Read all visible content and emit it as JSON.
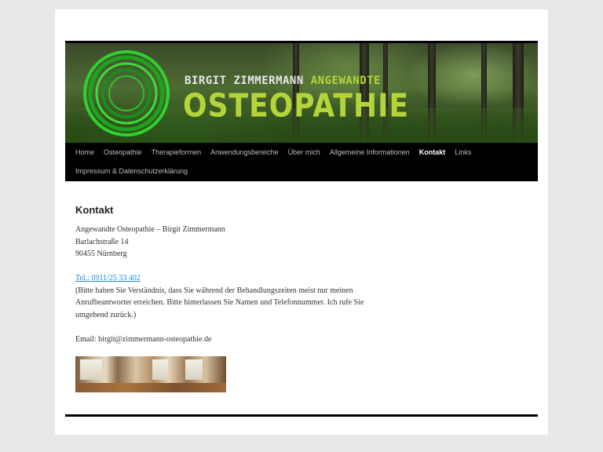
{
  "header": {
    "brand_name": "BIRGIT ZIMMERMANN",
    "brand_accent": "ANGEWANDTE",
    "brand_title": "OSTEOPATHIE",
    "brand_color": "#b4d43a"
  },
  "nav": {
    "row1": [
      "Home",
      "Osteopathie",
      "Therapieformen",
      "Anwendungsbereiche",
      "Über mich",
      "Allgemeine Informationen",
      "Kontakt",
      "Links"
    ],
    "row2": [
      "Impressum & Datenschutzerklärung"
    ],
    "active": "Kontakt"
  },
  "content": {
    "title": "Kontakt",
    "address": [
      "Angewandte Osteopathie – Birgit Zimmermann",
      "Barlachstraße 14",
      "90455 Nürnberg"
    ],
    "phone_link": "Tel.: 0911/25 33 402",
    "note_lines": [
      "(Bitte haben Sie Verständnis, dass Sie während der Behandlungszeiten meist nur meinen",
      "Anrufbeantworter erreichen. Bitte hinterlassen Sie Namen und Telefonnummer. Ich rufe Sie",
      "umgehend zurück.)"
    ],
    "email": "Email: birgit@zimmermann-osteopathie.de",
    "link_color": "#1b8be0"
  }
}
